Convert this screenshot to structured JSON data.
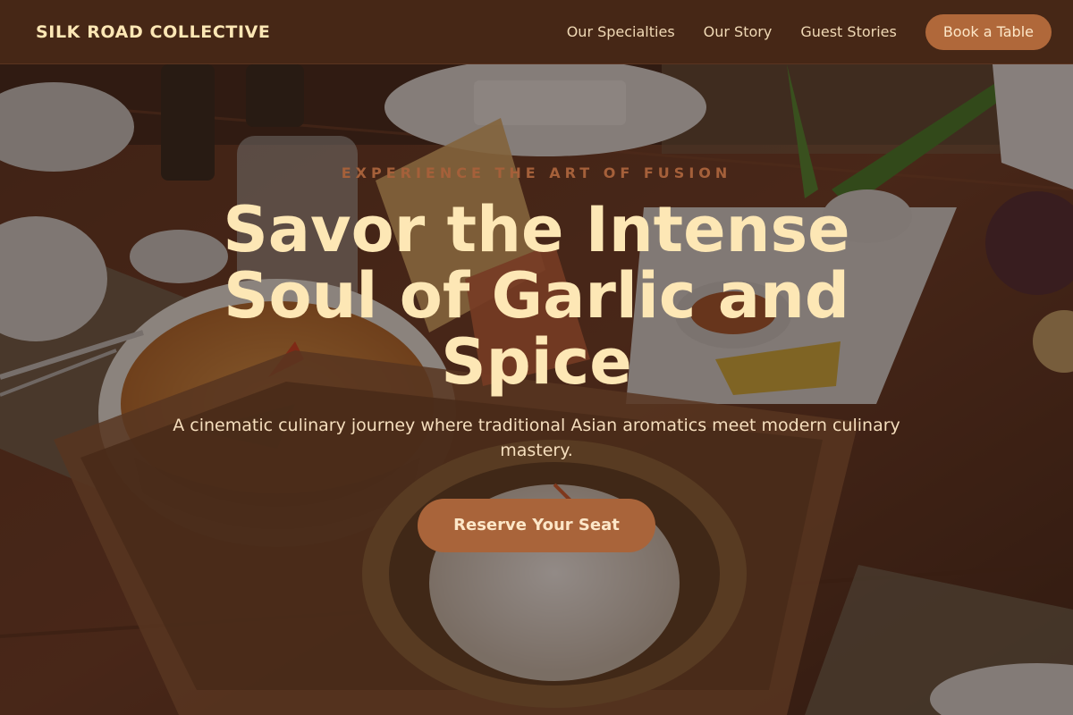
{
  "brand": {
    "name": "SILK ROAD COLLECTIVE"
  },
  "nav": {
    "links": [
      "Our Specialties",
      "Our Story",
      "Guest Stories"
    ],
    "cta_label": "Book a Table"
  },
  "hero": {
    "eyebrow": "EXPERIENCE THE ART OF FUSION",
    "headline": "Savor the Intense Soul of Garlic and Spice",
    "subheadline": "A cinematic culinary journey where traditional Asian aromatics meet modern culinary mastery.",
    "cta_label": "Reserve Your Seat"
  },
  "colors": {
    "nav_background": "#462716",
    "brand_text": "#fde7b5",
    "accent": "#b0683a",
    "eyebrow": "#a5603a",
    "headline": "#fde7b5"
  }
}
